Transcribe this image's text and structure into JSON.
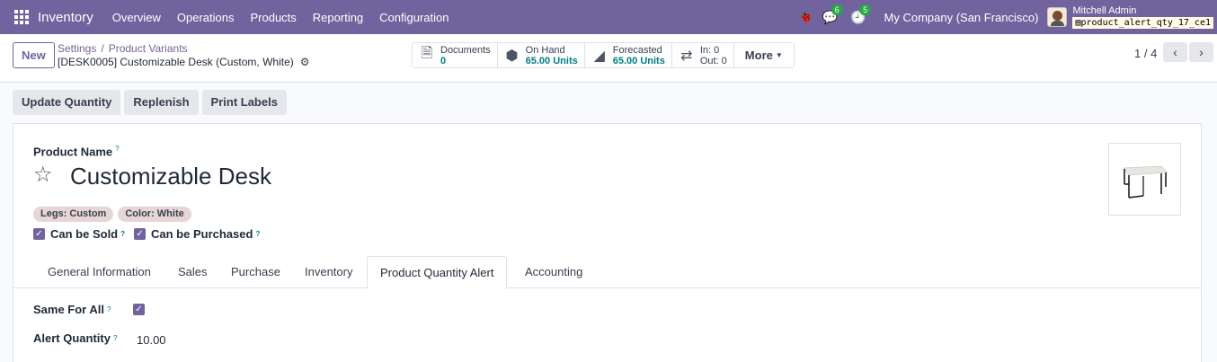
{
  "navbar": {
    "brand": "Inventory",
    "menu": [
      "Overview",
      "Operations",
      "Products",
      "Reporting",
      "Configuration"
    ],
    "messages_count": "6",
    "activities_count": "5",
    "company": "My Company (San Francisco)",
    "user_name": "Mitchell Admin",
    "database": "product_alert_qty_17_ce1"
  },
  "control": {
    "new_label": "New",
    "breadcrumb": [
      "Settings",
      "Product Variants"
    ],
    "record_title": "[DESK0005] Customizable Desk (Custom, White)",
    "smart_buttons": {
      "documents": {
        "label": "Documents",
        "value": "0"
      },
      "on_hand": {
        "label": "On Hand",
        "value": "65.00 Units"
      },
      "forecasted": {
        "label": "Forecasted",
        "value": "65.00 Units"
      },
      "in_label": "In: 0",
      "out_label": "Out: 0",
      "more": "More"
    },
    "pager": "1 / 4"
  },
  "actions": [
    "Update Quantity",
    "Replenish",
    "Print Labels"
  ],
  "form": {
    "product_name_label": "Product Name",
    "help_mark": "?",
    "product_name": "Customizable Desk",
    "tags": [
      "Legs: Custom",
      "Color: White"
    ],
    "can_be_sold": "Can be Sold",
    "can_be_purchased": "Can be Purchased",
    "tabs": [
      "General Information",
      "Sales",
      "Purchase",
      "Inventory",
      "Product Quantity Alert",
      "Accounting"
    ],
    "active_tab": "Product Quantity Alert",
    "same_for_all_label": "Same For All",
    "alert_quantity_label": "Alert Quantity",
    "alert_quantity_value": "10.00"
  },
  "colors": {
    "brand": "#71639e",
    "accent": "#017e84"
  }
}
